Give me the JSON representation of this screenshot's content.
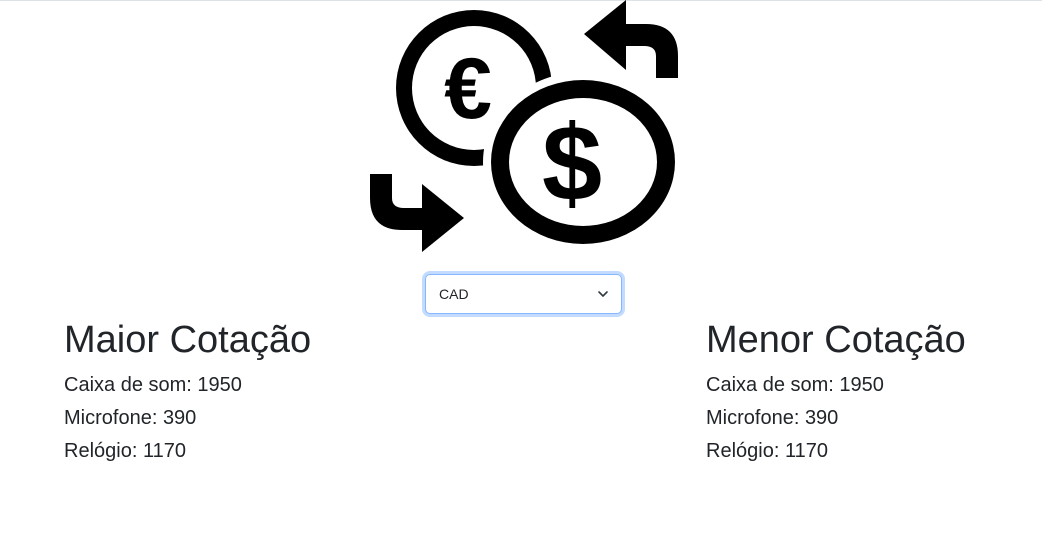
{
  "currency_select": {
    "selected": "CAD"
  },
  "highest_quote": {
    "title": "Maior Cotação",
    "items": [
      {
        "label": "Caixa de som",
        "value": "1950"
      },
      {
        "label": "Microfone",
        "value": "390"
      },
      {
        "label": "Relógio",
        "value": "1170"
      }
    ]
  },
  "lowest_quote": {
    "title": "Menor Cotação",
    "items": [
      {
        "label": "Caixa de som",
        "value": "1950"
      },
      {
        "label": "Microfone",
        "value": "390"
      },
      {
        "label": "Relógio",
        "value": "1170"
      }
    ]
  },
  "logo": {
    "icon": "currency-exchange-icon",
    "glyph_euro": "€",
    "glyph_dollar": "$"
  }
}
